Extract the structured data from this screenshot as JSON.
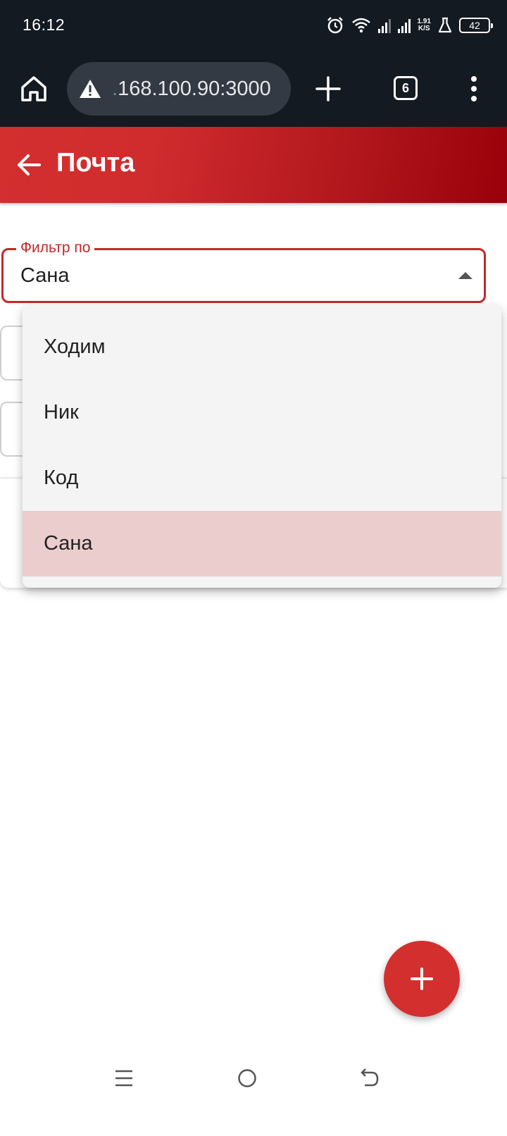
{
  "status_bar": {
    "time": "16:12",
    "net_speed_value": "1.91",
    "net_speed_unit": "K/S",
    "battery": "42",
    "icons": [
      "alarm-icon",
      "wifi-icon",
      "signal-icon",
      "signal-icon",
      "flask-icon",
      "battery-icon"
    ]
  },
  "browser": {
    "url_faded": ".",
    "url": "168.100.90:3000",
    "tab_count": "6"
  },
  "appbar": {
    "title": "Почта"
  },
  "filter": {
    "label": "Фильтр по",
    "value": "Сана"
  },
  "dropdown": {
    "options": [
      "Ходим",
      "Ник",
      "Код",
      "Сана"
    ],
    "selected_index": 3
  },
  "colors": {
    "primary": "#d32f2f",
    "primary_dark": "#990009",
    "selected_row": "#eccdcd",
    "menu_bg": "#f4f4f4"
  }
}
